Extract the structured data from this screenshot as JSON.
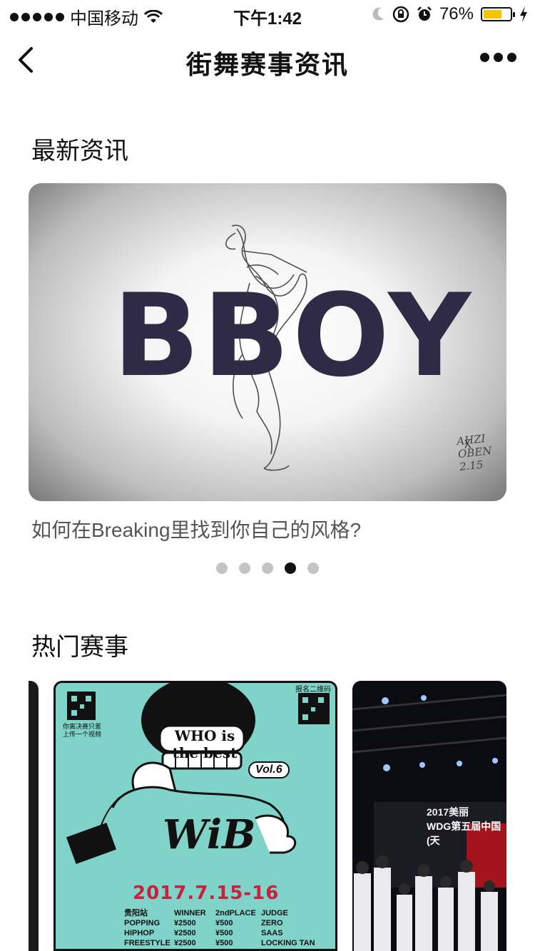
{
  "status_bar": {
    "carrier": "中国移动",
    "time": "下午1:42",
    "battery": "76%"
  },
  "nav": {
    "title": "街舞赛事资讯"
  },
  "news": {
    "section_title": "最新资讯",
    "banner_text": "BBOY",
    "signature": "AHZI OBEN 2.15",
    "caption": "如何在Breaking里找到你自己的风格?",
    "dots_count": 5,
    "active_dot": 4
  },
  "events": {
    "section_title": "热门赛事",
    "poster": {
      "head_text": "WHO is the best",
      "vol": "Vol.6",
      "logo": "WiB",
      "qr_left_label": "你离决赛只差\n上传一个视频",
      "qr_right_label": "报名二维码",
      "date": "2017.7.15-16",
      "table_header": [
        "贵阳站",
        "WINNER",
        "2ndPLACE",
        "JUDGE"
      ],
      "rows": [
        [
          "POPPING",
          "¥2500",
          "¥500",
          "ZERO"
        ],
        [
          "HIPHOP",
          "¥2500",
          "¥500",
          "SAAS"
        ],
        [
          "FREESTYLE",
          "¥2500",
          "¥500",
          "LOCKING TAN"
        ]
      ]
    },
    "stage": {
      "banner_text": "2017美丽"
    },
    "stage_sub": {
      "text": "WDG第五届中国(天"
    }
  },
  "colors": {
    "bboy_text": "#2f2a45",
    "poster_bg": "#7fd3c9",
    "poster_date": "#cc1f3b",
    "battery": "#f5c400",
    "dot_active": "#111111",
    "dot_inactive": "#c4c4c4"
  }
}
